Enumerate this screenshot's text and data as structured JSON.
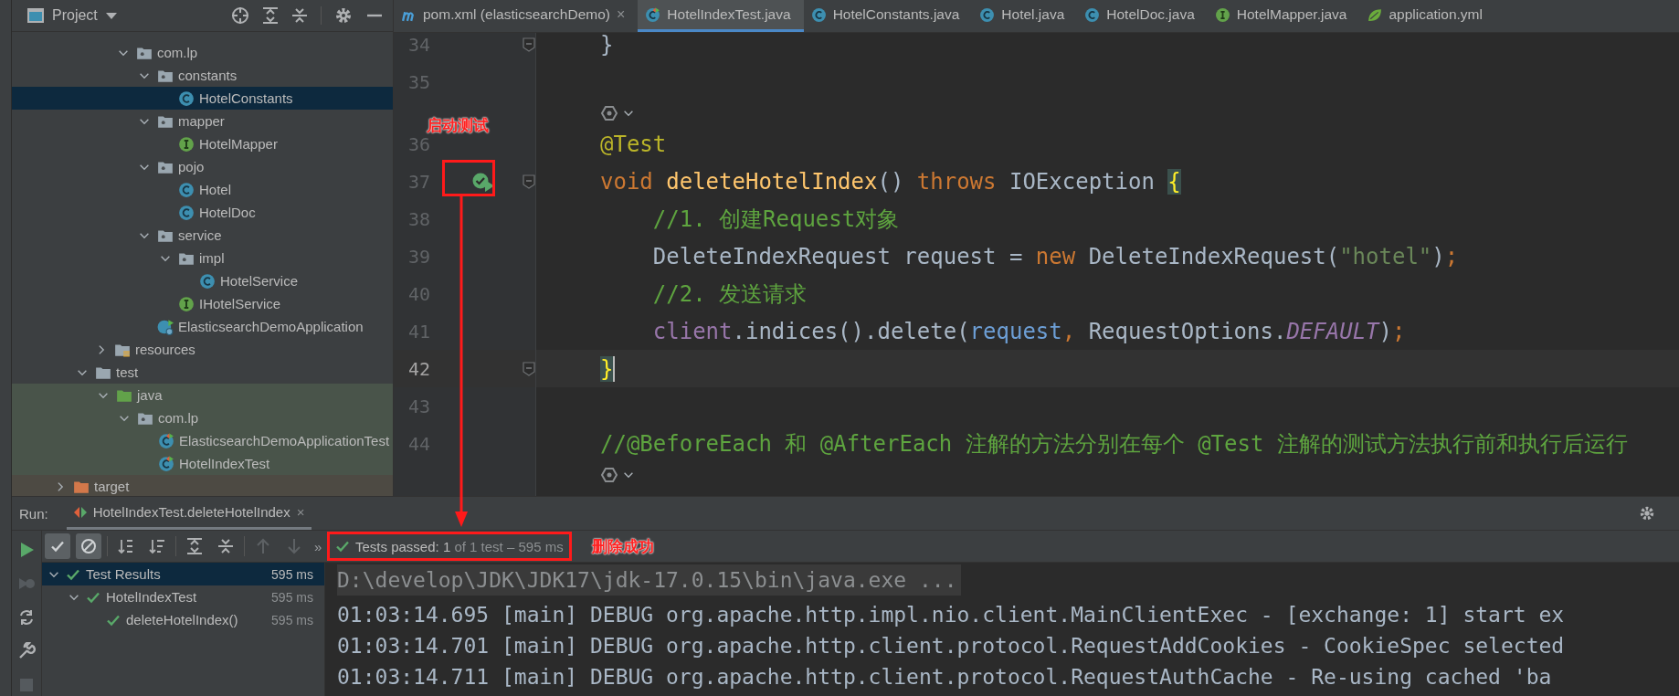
{
  "project_panel": {
    "title": "Project",
    "tree": [
      {
        "label": "com.lp",
        "kind": "package",
        "expanded": true,
        "selected": false,
        "children": [
          {
            "label": "constants",
            "kind": "package",
            "expanded": true,
            "selected": false,
            "children": [
              {
                "label": "HotelConstants",
                "kind": "class",
                "selected": true
              }
            ]
          },
          {
            "label": "mapper",
            "kind": "package",
            "expanded": true,
            "selected": false,
            "children": [
              {
                "label": "HotelMapper",
                "kind": "interface",
                "selected": false
              }
            ]
          },
          {
            "label": "pojo",
            "kind": "package",
            "expanded": true,
            "selected": false,
            "children": [
              {
                "label": "Hotel",
                "kind": "class",
                "selected": false
              },
              {
                "label": "HotelDoc",
                "kind": "class",
                "selected": false
              }
            ]
          },
          {
            "label": "service",
            "kind": "package",
            "expanded": true,
            "selected": false,
            "children": [
              {
                "label": "impl",
                "kind": "package",
                "expanded": true,
                "selected": false,
                "children": [
                  {
                    "label": "HotelService",
                    "kind": "class",
                    "selected": false
                  }
                ]
              },
              {
                "label": "IHotelService",
                "kind": "interface",
                "selected": false
              }
            ]
          },
          {
            "label": "ElasticsearchDemoApplication",
            "kind": "app",
            "selected": false
          }
        ]
      },
      {
        "label": "resources",
        "kind": "resources",
        "expanded": false,
        "selected": false
      },
      {
        "label": "test",
        "kind": "folder",
        "expanded": true,
        "selected": false,
        "children": [
          {
            "label": "java",
            "kind": "test-root",
            "expanded": true,
            "selected": false,
            "children": [
              {
                "label": "com.lp",
                "kind": "package",
                "expanded": true,
                "selected": false,
                "children": [
                  {
                    "label": "ElasticsearchDemoApplicationTest",
                    "kind": "test-class",
                    "selected": false
                  },
                  {
                    "label": "HotelIndexTest",
                    "kind": "test-class",
                    "selected": false
                  }
                ]
              }
            ]
          }
        ]
      },
      {
        "label": "target",
        "kind": "excluded",
        "expanded": false,
        "selected": false
      }
    ]
  },
  "editor": {
    "tabs": [
      {
        "label": "pom.xml (elasticsearchDemo)",
        "kind": "maven",
        "selected": false,
        "close": "×"
      },
      {
        "label": "HotelIndexTest.java",
        "kind": "test-class",
        "selected": true
      },
      {
        "label": "HotelConstants.java",
        "kind": "class",
        "selected": false
      },
      {
        "label": "Hotel.java",
        "kind": "class",
        "selected": false
      },
      {
        "label": "HotelDoc.java",
        "kind": "class",
        "selected": false
      },
      {
        "label": "HotelMapper.java",
        "kind": "interface",
        "selected": false
      },
      {
        "label": "application.yml",
        "kind": "yaml",
        "selected": false
      }
    ],
    "annotation": "启动测试",
    "lines": [
      {
        "kind": "code",
        "number": "34",
        "current": false,
        "fold": true,
        "tokens": [
          {
            "text": "}",
            "kind": "plain"
          }
        ]
      },
      {
        "kind": "code",
        "number": "35",
        "current": false,
        "fold": false
      },
      {
        "kind": "hint"
      },
      {
        "kind": "code",
        "number": "36",
        "current": false,
        "fold": false,
        "tokens": [
          {
            "text": "@Test",
            "kind": "annotation"
          }
        ]
      },
      {
        "kind": "code",
        "number": "37",
        "current": false,
        "fold": true,
        "run_marker": true,
        "tokens": [
          {
            "text": "void ",
            "kind": "keyword"
          },
          {
            "text": "deleteHotelIndex",
            "kind": "method"
          },
          {
            "text": "() ",
            "kind": "plain"
          },
          {
            "text": "throws",
            "kind": "keyword"
          },
          {
            "text": " IOException ",
            "kind": "plain"
          },
          {
            "text": "{",
            "kind": "brace"
          }
        ]
      },
      {
        "kind": "code",
        "number": "38",
        "current": false,
        "fold": false,
        "tokens": [
          {
            "text": "    //1. 创建Request对象",
            "kind": "comment"
          }
        ]
      },
      {
        "kind": "code",
        "number": "39",
        "current": false,
        "fold": false,
        "tokens": [
          {
            "text": "    DeleteIndexRequest request = ",
            "kind": "plain"
          },
          {
            "text": "new",
            "kind": "keyword"
          },
          {
            "text": " DeleteIndexRequest(",
            "kind": "plain"
          },
          {
            "text": "\"hotel\"",
            "kind": "string"
          },
          {
            "text": ")",
            "kind": "plain"
          },
          {
            "text": ";",
            "kind": "keyword"
          }
        ]
      },
      {
        "kind": "code",
        "number": "40",
        "current": false,
        "fold": false,
        "tokens": [
          {
            "text": "    //2. 发送请求",
            "kind": "comment"
          }
        ]
      },
      {
        "kind": "code",
        "number": "41",
        "current": false,
        "fold": false,
        "tokens": [
          {
            "text": "    client",
            "kind": "field"
          },
          {
            "text": ".indices().delete(",
            "kind": "plain"
          },
          {
            "text": "request",
            "kind": "param"
          },
          {
            "text": ",",
            "kind": "keyword"
          },
          {
            "text": " RequestOptions.",
            "kind": "plain"
          },
          {
            "text": "DEFAULT",
            "kind": "static"
          },
          {
            "text": ")",
            "kind": "plain"
          },
          {
            "text": ";",
            "kind": "keyword"
          }
        ]
      },
      {
        "kind": "code",
        "number": "42",
        "current": true,
        "fold": true,
        "tokens": [
          {
            "text": "}",
            "kind": "brace"
          }
        ]
      },
      {
        "kind": "code",
        "number": "43",
        "current": false,
        "fold": false
      },
      {
        "kind": "code",
        "number": "44",
        "current": false,
        "fold": false,
        "tokens": [
          {
            "text": "//@BeforeEach 和 @AfterEach 注解的方法分别在每个 @Test 注解的测试方法执行前和执行后运行",
            "kind": "comment"
          }
        ]
      },
      {
        "kind": "hint"
      }
    ]
  },
  "run_panel": {
    "label": "Run:",
    "tab": "HotelIndexTest.deleteHotelIndex",
    "tab_close": "×",
    "filters": [
      {
        "kind": "passed",
        "on": true
      },
      {
        "kind": "ignored",
        "on": true
      }
    ],
    "sorts": [
      {
        "kind": "alpha",
        "on": false
      },
      {
        "kind": "duration",
        "on": false
      }
    ],
    "overflow": "»",
    "status": {
      "kind": "passed",
      "count": "Tests passed: 1",
      "detail": "of 1 test – 595 ms"
    },
    "annotation": "删除成功",
    "results": [
      {
        "label": "Test Results",
        "time": "595 ms",
        "kind": "passed",
        "expanded": true,
        "selected": true,
        "children": [
          {
            "label": "HotelIndexTest",
            "time": "595 ms",
            "kind": "passed",
            "expanded": true,
            "selected": false,
            "children": [
              {
                "label": "deleteHotelIndex()",
                "time": "595 ms",
                "kind": "passed",
                "selected": false
              }
            ]
          }
        ]
      }
    ],
    "console": [
      {
        "kind": "command",
        "text": "D:\\develop\\JDK\\JDK17\\jdk-17.0.15\\bin\\java.exe ..."
      },
      {
        "kind": "log",
        "text": "01:03:14.695 [main] DEBUG org.apache.http.impl.nio.client.MainClientExec - [exchange: 1] start ex"
      },
      {
        "kind": "log",
        "text": "01:03:14.701 [main] DEBUG org.apache.http.client.protocol.RequestAddCookies - CookieSpec selected"
      },
      {
        "kind": "log",
        "text": "01:03:14.711 [main] DEBUG org.apache.http.client.protocol.RequestAuthCache - Re-using cached 'ba"
      }
    ]
  }
}
